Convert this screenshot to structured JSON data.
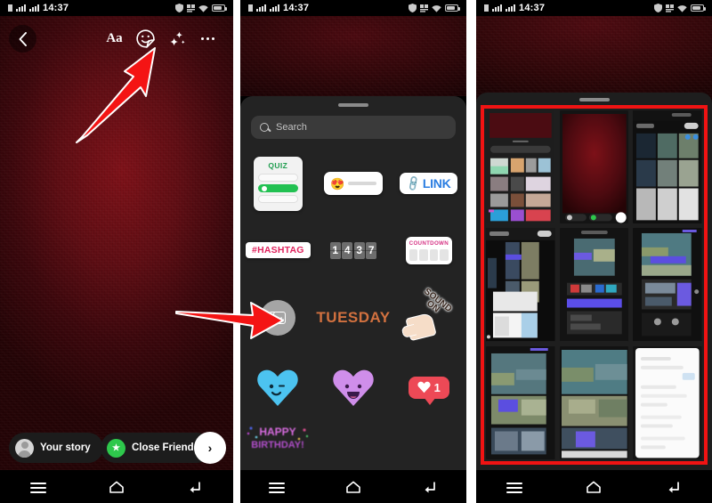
{
  "meta": {
    "app": "Instagram Stories",
    "platform": "Android",
    "panel_count": 3
  },
  "status_bar": {
    "time": "14:37",
    "icons_left": [
      "sim-dot-icon",
      "signal-bars-icon",
      "signal-bars-icon"
    ],
    "icons_right": [
      "shield-icon",
      "data-speed-icon",
      "wifi-icon",
      "battery-icon"
    ]
  },
  "nav_bar": {
    "items": [
      {
        "name": "recents-button",
        "icon": "menu-icon"
      },
      {
        "name": "home-button",
        "icon": "home-icon"
      },
      {
        "name": "back-button",
        "icon": "back-icon"
      }
    ]
  },
  "panel1": {
    "name": "story-composer",
    "top_bar": [
      {
        "name": "back-button",
        "icon": "chevron-left-icon",
        "label": ""
      },
      {
        "name": "text-tool-button",
        "icon": "text-aa-icon",
        "label": "Aa"
      },
      {
        "name": "sticker-tool-button",
        "icon": "sticker-face-icon",
        "label": ""
      },
      {
        "name": "effects-button",
        "icon": "sparkles-icon",
        "label": ""
      },
      {
        "name": "more-options-button",
        "icon": "more-dots-icon",
        "label": ""
      }
    ],
    "bottom_actions": {
      "your_story_label": "Your story",
      "close_friends_label": "Close Friends",
      "next_label": "›"
    },
    "annotation": {
      "arrow": "arrow-pointing-to-sticker-button"
    }
  },
  "panel2": {
    "name": "sticker-tray",
    "search": {
      "placeholder": "Search",
      "value": ""
    },
    "stickers": [
      {
        "name": "quiz-sticker",
        "label": "QUIZ",
        "options": 3,
        "selected_index": 1
      },
      {
        "name": "slider-sticker",
        "emoji": "😍",
        "label": ""
      },
      {
        "name": "link-sticker",
        "label": "LINK"
      },
      {
        "name": "hashtag-sticker",
        "label": "#HASHTAG"
      },
      {
        "name": "clock-sticker",
        "label": "1437",
        "digits": [
          "1",
          "4",
          "3",
          "7"
        ]
      },
      {
        "name": "countdown-sticker",
        "label": "COUNTDOWN"
      },
      {
        "name": "add-yours-sticker",
        "label": ""
      },
      {
        "name": "day-sticker",
        "label": "TUESDAY"
      },
      {
        "name": "sound-on-sticker",
        "label": "SOUND ON",
        "line1": "SOUND",
        "line2": "ON"
      },
      {
        "name": "blue-heart-sticker",
        "label": "",
        "color": "#4cc3f0"
      },
      {
        "name": "purple-heart-sticker",
        "label": "",
        "color": "#cf8eea"
      },
      {
        "name": "like-count-sticker",
        "label": "1",
        "color": "#ed4956"
      },
      {
        "name": "happy-birthday-sticker",
        "label": "HAPPY BIRTHDAY!"
      }
    ],
    "annotation": {
      "arrow": "arrow-pointing-to-add-yours-sticker"
    }
  },
  "panel3": {
    "name": "photo-picker-grid",
    "selection_box": {
      "name": "red-highlight-box",
      "color": "#f01313"
    },
    "thumbnails": [
      {
        "name": "thumb-1",
        "kind": "screenshot-sticker-tray"
      },
      {
        "name": "thumb-2",
        "kind": "screenshot-red-story"
      },
      {
        "name": "thumb-3",
        "kind": "screenshot-gallery"
      },
      {
        "name": "thumb-4",
        "kind": "screenshot-gallery-dark"
      },
      {
        "name": "thumb-5",
        "kind": "screenshot-music"
      },
      {
        "name": "thumb-6",
        "kind": "screenshot-photo"
      },
      {
        "name": "thumb-7",
        "kind": "screenshot-photo"
      },
      {
        "name": "thumb-8",
        "kind": "screenshot-photo"
      },
      {
        "name": "thumb-9",
        "kind": "screenshot-white-doc"
      }
    ]
  },
  "colors": {
    "arrow_red": "#f41414",
    "highlight_red": "#f01313",
    "tray_bg": "#232323",
    "story_red": "#5d0d13",
    "green_accent": "#22c152",
    "link_blue": "#2a7de1",
    "hashtag_pink": "#e0245e",
    "tuesday_orange": "#d2713f"
  }
}
